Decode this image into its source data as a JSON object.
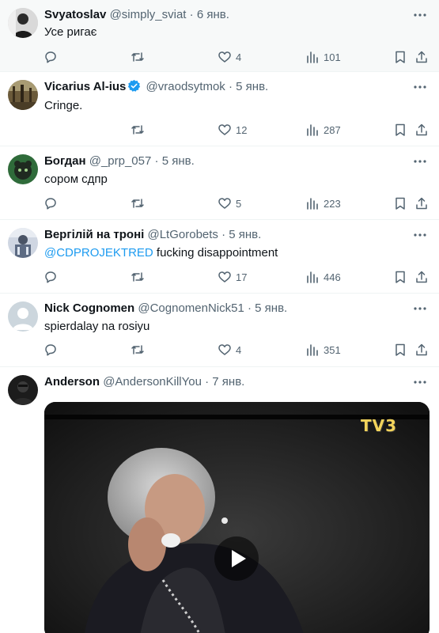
{
  "tweets": [
    {
      "name": "Svyatoslav",
      "handle": "@simply_sviat",
      "date": "6 янв.",
      "text": "Усе ригає",
      "likes": "4",
      "views": "101"
    },
    {
      "name": "Vicarius Al-ius",
      "handle": "@vraodsytmok",
      "date": "5 янв.",
      "text": "Cringe.",
      "likes": "12",
      "views": "287"
    },
    {
      "name": "Богдан",
      "handle": "@_prp_057",
      "date": "5 янв.",
      "text": "сором сдпр",
      "likes": "5",
      "views": "223"
    },
    {
      "name": "Вергілій на троні",
      "handle": "@LtGorobets",
      "date": "5 янв.",
      "mention": "@CDPROJEKTRED",
      "text": "fucking disappointment",
      "likes": "17",
      "views": "446"
    },
    {
      "name": "Nick Cognomen",
      "handle": "@CognomenNick51",
      "date": "5 янв.",
      "text": "spierdalay na rosiyu",
      "likes": "4",
      "views": "351"
    },
    {
      "name": "Anderson",
      "handle": "@AndersonKillYou",
      "date": "7 янв.",
      "media_logo": "TV3"
    }
  ],
  "separator": "·",
  "colors": {
    "accent": "#1d9bf0",
    "secondary": "#536471",
    "divider": "#eff3f4",
    "highlight_bg": "#f7f9f9"
  },
  "icons": [
    "reply-icon",
    "retweet-icon",
    "like-icon",
    "views-icon",
    "bookmark-icon",
    "share-icon",
    "more-icon",
    "verified-badge-icon",
    "play-icon"
  ]
}
